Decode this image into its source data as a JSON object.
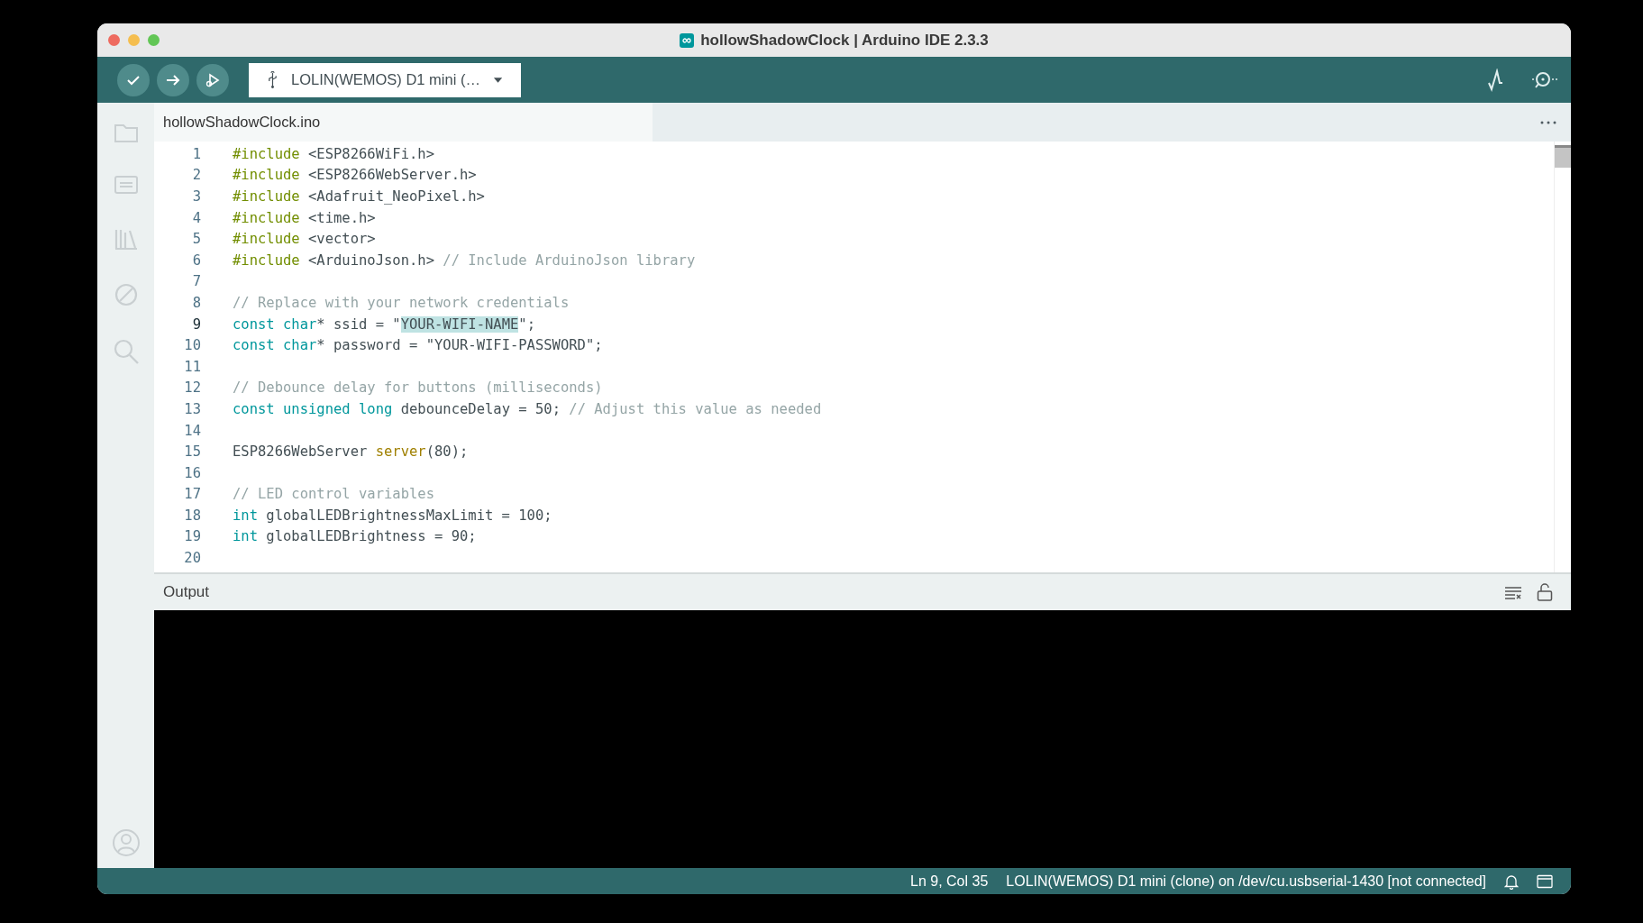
{
  "window": {
    "title": "hollowShadowClock | Arduino IDE 2.3.3"
  },
  "toolbar": {
    "buttons": [
      {
        "kind": "verify"
      },
      {
        "kind": "upload"
      },
      {
        "kind": "debug"
      }
    ],
    "board": "LOLIN(WEMOS) D1 mini (…",
    "right_buttons": [
      {
        "kind": "plotter"
      },
      {
        "kind": "monitor"
      }
    ]
  },
  "tabs": [
    {
      "label": "hollowShadowClock.ino",
      "selected": true
    }
  ],
  "sidebar": {
    "items": [
      {
        "kind": "sketchbook"
      },
      {
        "kind": "boards"
      },
      {
        "kind": "library"
      },
      {
        "kind": "debug"
      },
      {
        "kind": "search"
      }
    ],
    "bottom": [
      {
        "kind": "profile"
      }
    ]
  },
  "editor": {
    "lines": [
      {
        "number": "1",
        "current": false,
        "tokens": [
          {
            "kind": "directive",
            "text": "#include"
          },
          {
            "kind": "plain",
            "text": " <ESP8266WiFi.h>"
          }
        ]
      },
      {
        "number": "2",
        "current": false,
        "tokens": [
          {
            "kind": "directive",
            "text": "#include"
          },
          {
            "kind": "plain",
            "text": " <ESP8266WebServer.h>"
          }
        ]
      },
      {
        "number": "3",
        "current": false,
        "tokens": [
          {
            "kind": "directive",
            "text": "#include"
          },
          {
            "kind": "plain",
            "text": " <Adafruit_NeoPixel.h>"
          }
        ]
      },
      {
        "number": "4",
        "current": false,
        "tokens": [
          {
            "kind": "directive",
            "text": "#include"
          },
          {
            "kind": "plain",
            "text": " <time.h>"
          }
        ]
      },
      {
        "number": "5",
        "current": false,
        "tokens": [
          {
            "kind": "directive",
            "text": "#include"
          },
          {
            "kind": "plain",
            "text": " <vector>"
          }
        ]
      },
      {
        "number": "6",
        "current": false,
        "tokens": [
          {
            "kind": "directive",
            "text": "#include"
          },
          {
            "kind": "plain",
            "text": " <ArduinoJson.h> "
          },
          {
            "kind": "comment",
            "text": "// Include ArduinoJson library"
          }
        ]
      },
      {
        "number": "7",
        "current": false
      },
      {
        "number": "8",
        "current": false,
        "tokens": [
          {
            "kind": "comment",
            "text": "// Replace with your network credentials"
          }
        ]
      },
      {
        "number": "9",
        "current": true,
        "tokens": [
          {
            "kind": "type",
            "text": "const "
          },
          {
            "kind": "type",
            "text": "char"
          },
          {
            "kind": "plain",
            "text": "* ssid = \""
          },
          {
            "kind": "selected",
            "text": "YOUR-WIFI-NAME"
          },
          {
            "kind": "plain",
            "text": "\";"
          }
        ]
      },
      {
        "number": "10",
        "current": false,
        "tokens": [
          {
            "kind": "type",
            "text": "const "
          },
          {
            "kind": "type",
            "text": "char"
          },
          {
            "kind": "plain",
            "text": "* password = \"YOUR-WIFI-PASSWORD\";"
          }
        ]
      },
      {
        "number": "11",
        "current": false
      },
      {
        "number": "12",
        "current": false,
        "tokens": [
          {
            "kind": "comment",
            "text": "// Debounce delay for buttons (milliseconds)"
          }
        ]
      },
      {
        "number": "13",
        "current": false,
        "tokens": [
          {
            "kind": "type",
            "text": "const "
          },
          {
            "kind": "type",
            "text": "unsigned "
          },
          {
            "kind": "type",
            "text": "long"
          },
          {
            "kind": "plain",
            "text": " debounceDelay = 50; "
          },
          {
            "kind": "comment",
            "text": "// Adjust this value as needed"
          }
        ]
      },
      {
        "number": "14",
        "current": false
      },
      {
        "number": "15",
        "current": false,
        "tokens": [
          {
            "kind": "plain",
            "text": "ESP8266WebServer "
          },
          {
            "kind": "func",
            "text": "server"
          },
          {
            "kind": "plain",
            "text": "(80);"
          }
        ]
      },
      {
        "number": "16",
        "current": false
      },
      {
        "number": "17",
        "current": false,
        "tokens": [
          {
            "kind": "comment",
            "text": "// LED control variables"
          }
        ]
      },
      {
        "number": "18",
        "current": false,
        "tokens": [
          {
            "kind": "type",
            "text": "int"
          },
          {
            "kind": "plain",
            "text": " globalLEDBrightnessMaxLimit = 100;"
          }
        ]
      },
      {
        "number": "19",
        "current": false,
        "tokens": [
          {
            "kind": "type",
            "text": "int"
          },
          {
            "kind": "plain",
            "text": " globalLEDBrightness = 90;"
          }
        ]
      },
      {
        "number": "20",
        "current": false
      }
    ]
  },
  "output": {
    "title": "Output"
  },
  "status_bar": {
    "position": "Ln 9, Col 35",
    "board": "LOLIN(WEMOS) D1 mini (clone) on /dev/cu.usbserial-1430 [not connected]"
  }
}
